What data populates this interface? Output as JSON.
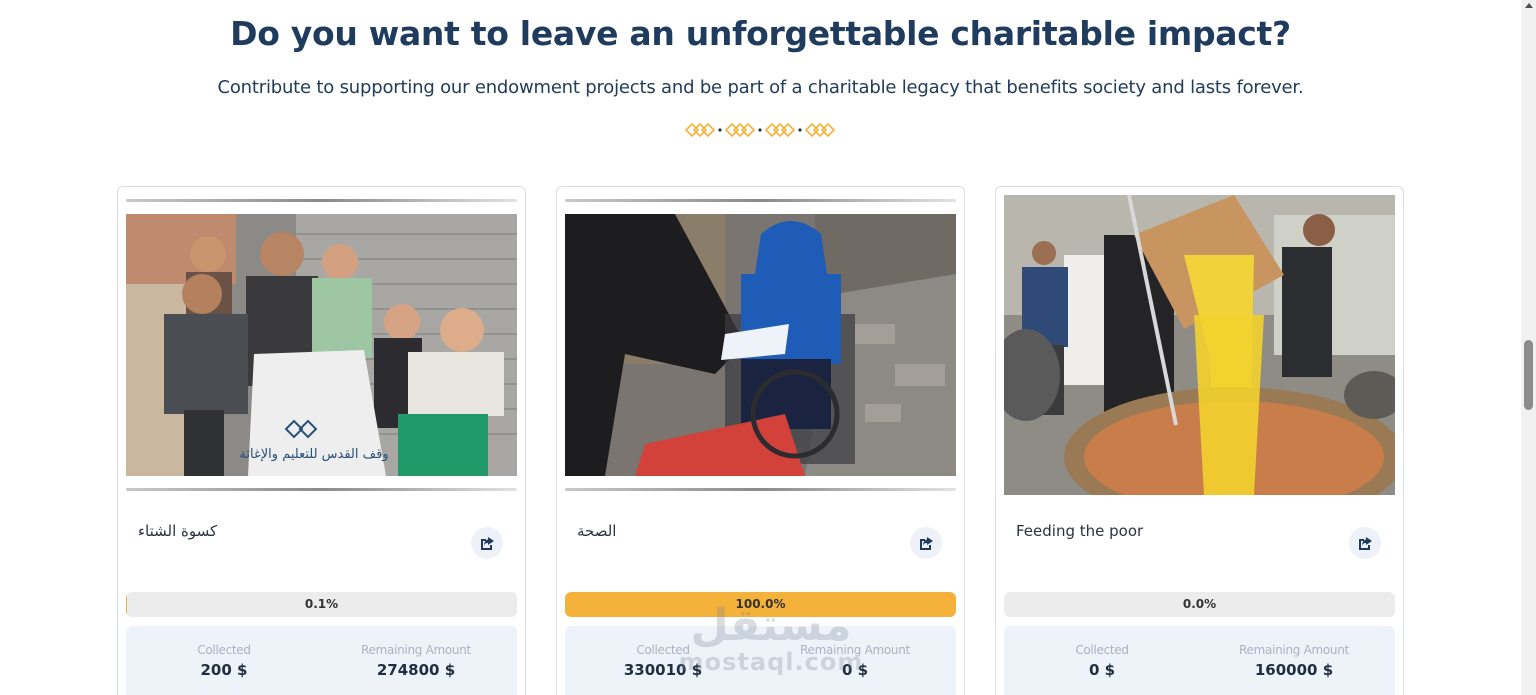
{
  "section": {
    "title": "Do you want to leave an unforgettable charitable impact?",
    "subtitle": "Contribute to supporting our endowment projects and be part of a charitable legacy that benefits society and lasts forever.",
    "ornament_icon": "diamond-chain-ornament",
    "accent_color": "#f5b23a"
  },
  "cards": [
    {
      "title": "كسوة الشتاء",
      "progress_label": "0.1%",
      "progress_fraction": 0.001,
      "collected_label": "Collected",
      "collected_value": "200 $",
      "remaining_label": "Remaining Amount",
      "remaining_value": "274800 $",
      "image_text": "وقف القدس للتعليم والإغاثة",
      "share_icon": "share-icon"
    },
    {
      "title": "الصحة",
      "progress_label": "100.0%",
      "progress_fraction": 1.0,
      "collected_label": "Collected",
      "collected_value": "330010 $",
      "remaining_label": "Remaining Amount",
      "remaining_value": "0 $",
      "share_icon": "share-icon"
    },
    {
      "title": "Feeding the poor",
      "progress_label": "0.0%",
      "progress_fraction": 0.0,
      "collected_label": "Collected",
      "collected_value": "0 $",
      "remaining_label": "Remaining Amount",
      "remaining_value": "160000 $",
      "share_icon": "share-icon"
    }
  ],
  "watermark": {
    "line1": "مستقل",
    "line2": "mostaql.com"
  }
}
